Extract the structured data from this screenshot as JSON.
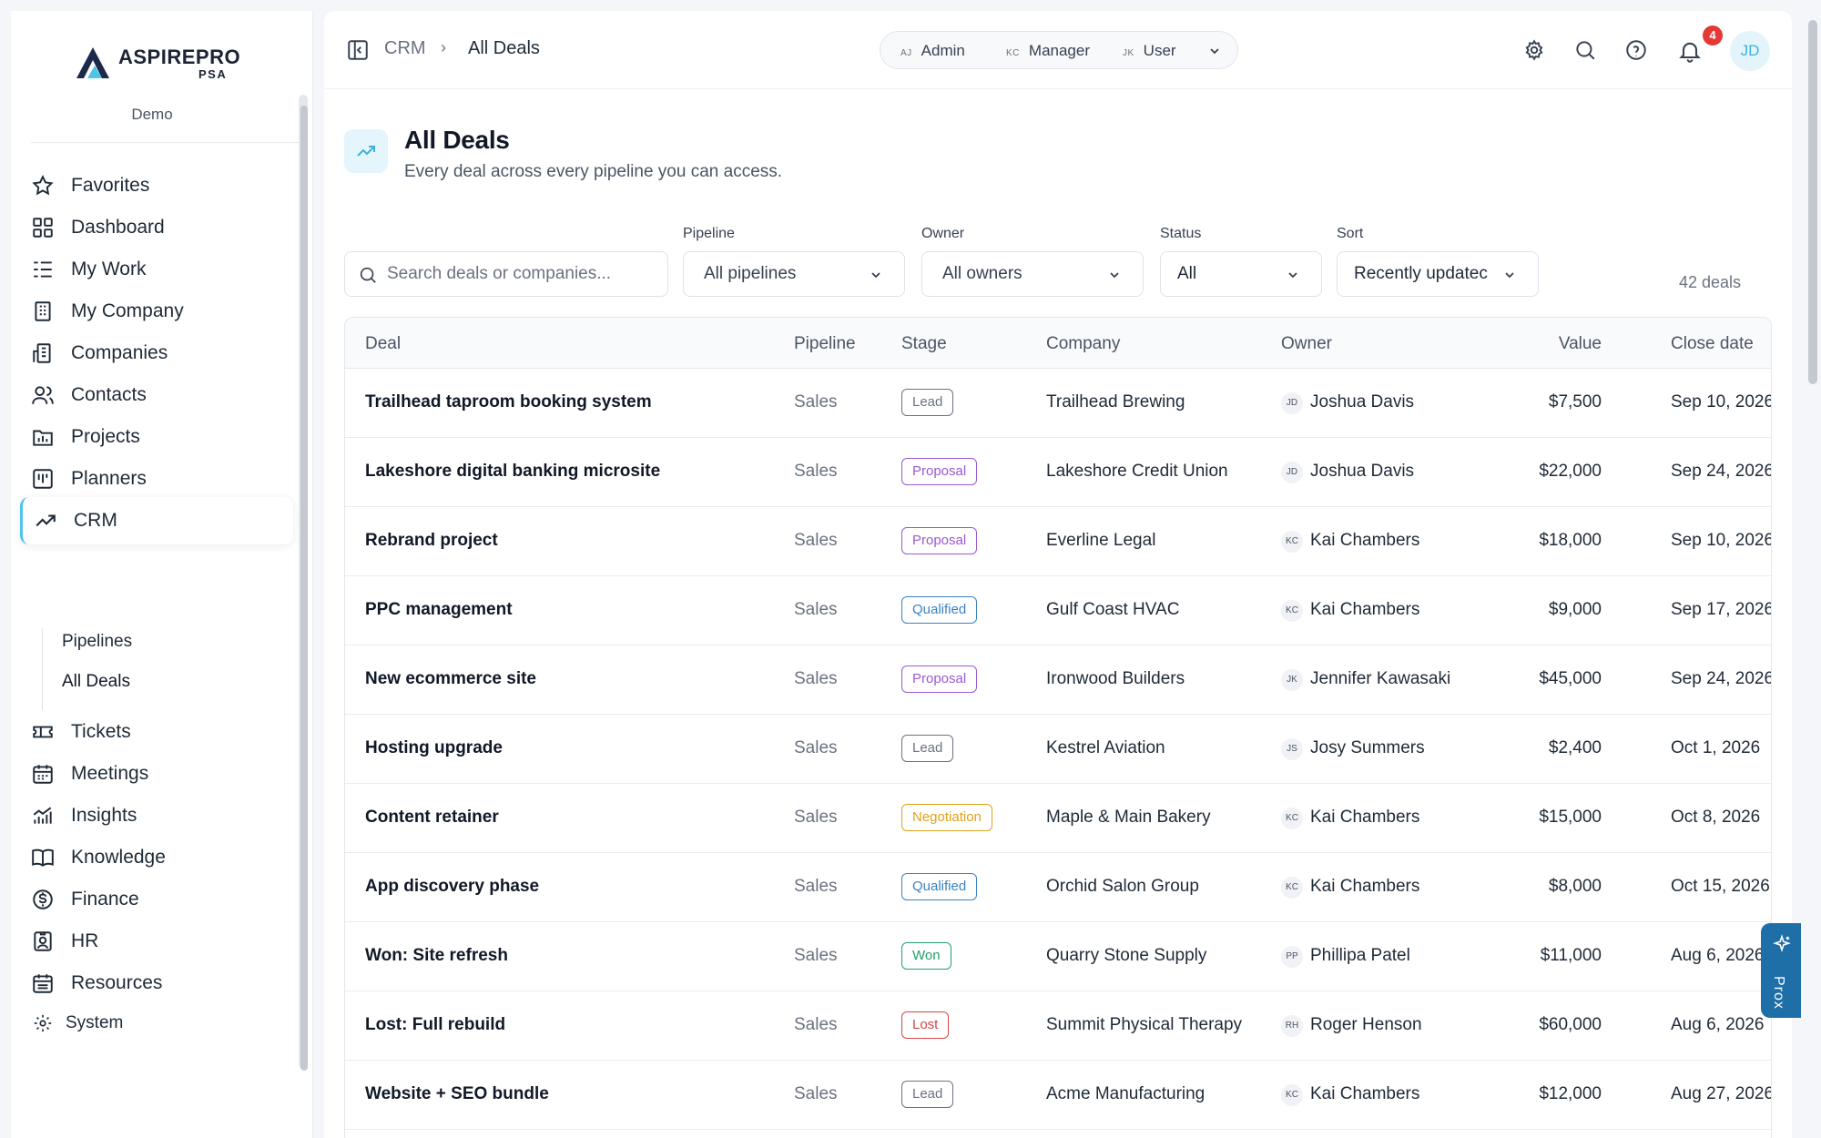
{
  "brand": {
    "name": "ASPIREPRO",
    "sub": "PSA",
    "tenant": "Demo"
  },
  "sidebar": {
    "items": [
      {
        "label": "Favorites",
        "icon": "star-icon"
      },
      {
        "label": "Dashboard",
        "icon": "grid-icon"
      },
      {
        "label": "My Work",
        "icon": "checklist-icon"
      },
      {
        "label": "My Company",
        "icon": "building-icon"
      },
      {
        "label": "Companies",
        "icon": "buildings-icon"
      },
      {
        "label": "Contacts",
        "icon": "users-icon"
      },
      {
        "label": "Projects",
        "icon": "folder-chart-icon"
      },
      {
        "label": "Planners",
        "icon": "board-icon"
      },
      {
        "label": "CRM",
        "icon": "trend-icon"
      },
      {
        "label": "Tickets",
        "icon": "ticket-icon"
      },
      {
        "label": "Meetings",
        "icon": "calendar-icon"
      },
      {
        "label": "Insights",
        "icon": "bar-chart-icon"
      },
      {
        "label": "Knowledge",
        "icon": "book-icon"
      },
      {
        "label": "Finance",
        "icon": "dollar-circle-icon"
      },
      {
        "label": "HR",
        "icon": "id-badge-icon"
      },
      {
        "label": "Resources",
        "icon": "calendar-list-icon"
      }
    ],
    "crm_sub": [
      {
        "label": "Pipelines"
      },
      {
        "label": "All Deals"
      }
    ],
    "system_label": "System"
  },
  "topbar": {
    "breadcrumb": [
      "CRM",
      "All Deals"
    ],
    "roles": [
      {
        "initials": "AJ",
        "label": "Admin"
      },
      {
        "initials": "KC",
        "label": "Manager"
      },
      {
        "initials": "JK",
        "label": "User"
      }
    ],
    "notification_count": "4",
    "avatar_initials": "JD"
  },
  "page": {
    "title": "All Deals",
    "subtitle": "Every deal across every pipeline you can access."
  },
  "filters": {
    "search_placeholder": "Search deals or companies...",
    "pipeline_label": "Pipeline",
    "pipeline_value": "All pipelines",
    "owner_label": "Owner",
    "owner_value": "All owners",
    "status_label": "Status",
    "status_value": "All",
    "sort_label": "Sort",
    "sort_value": "Recently updatec",
    "count": "42 deals"
  },
  "table": {
    "headers": [
      "Deal",
      "Pipeline",
      "Stage",
      "Company",
      "Owner",
      "Value",
      "Close date"
    ],
    "stage_colors": {
      "Lead": "#6b7280",
      "Proposal": "#9b59d0",
      "Qualified": "#3b82c4",
      "Negotiation": "#e0a21a",
      "Won": "#22a06b",
      "Lost": "#d64545"
    },
    "rows": [
      {
        "deal": "Trailhead taproom booking system",
        "pipeline": "Sales",
        "stage": "Lead",
        "company": "Trailhead Brewing",
        "owner_initials": "JD",
        "owner": "Joshua Davis",
        "value": "$7,500",
        "close": "Sep 10, 2026"
      },
      {
        "deal": "Lakeshore digital banking microsite",
        "pipeline": "Sales",
        "stage": "Proposal",
        "company": "Lakeshore Credit Union",
        "owner_initials": "JD",
        "owner": "Joshua Davis",
        "value": "$22,000",
        "close": "Sep 24, 2026"
      },
      {
        "deal": "Rebrand project",
        "pipeline": "Sales",
        "stage": "Proposal",
        "company": "Everline Legal",
        "owner_initials": "KC",
        "owner": "Kai Chambers",
        "value": "$18,000",
        "close": "Sep 10, 2026"
      },
      {
        "deal": "PPC management",
        "pipeline": "Sales",
        "stage": "Qualified",
        "company": "Gulf Coast HVAC",
        "owner_initials": "KC",
        "owner": "Kai Chambers",
        "value": "$9,000",
        "close": "Sep 17, 2026"
      },
      {
        "deal": "New ecommerce site",
        "pipeline": "Sales",
        "stage": "Proposal",
        "company": "Ironwood Builders",
        "owner_initials": "JK",
        "owner": "Jennifer Kawasaki",
        "value": "$45,000",
        "close": "Sep 24, 2026"
      },
      {
        "deal": "Hosting upgrade",
        "pipeline": "Sales",
        "stage": "Lead",
        "company": "Kestrel Aviation",
        "owner_initials": "JS",
        "owner": "Josy Summers",
        "value": "$2,400",
        "close": "Oct 1, 2026"
      },
      {
        "deal": "Content retainer",
        "pipeline": "Sales",
        "stage": "Negotiation",
        "company": "Maple & Main Bakery",
        "owner_initials": "KC",
        "owner": "Kai Chambers",
        "value": "$15,000",
        "close": "Oct 8, 2026"
      },
      {
        "deal": "App discovery phase",
        "pipeline": "Sales",
        "stage": "Qualified",
        "company": "Orchid Salon Group",
        "owner_initials": "KC",
        "owner": "Kai Chambers",
        "value": "$8,000",
        "close": "Oct 15, 2026"
      },
      {
        "deal": "Won: Site refresh",
        "pipeline": "Sales",
        "stage": "Won",
        "company": "Quarry Stone Supply",
        "owner_initials": "PP",
        "owner": "Phillipa Patel",
        "value": "$11,000",
        "close": "Aug 6, 2026"
      },
      {
        "deal": "Lost: Full rebuild",
        "pipeline": "Sales",
        "stage": "Lost",
        "company": "Summit Physical Therapy",
        "owner_initials": "RH",
        "owner": "Roger Henson",
        "value": "$60,000",
        "close": "Aug 6, 2026"
      },
      {
        "deal": "Website + SEO bundle",
        "pipeline": "Sales",
        "stage": "Lead",
        "company": "Acme Manufacturing",
        "owner_initials": "KC",
        "owner": "Kai Chambers",
        "value": "$12,000",
        "close": "Aug 27, 2026"
      }
    ]
  },
  "assistant": {
    "label": "Prox"
  },
  "colors": {
    "accent": "#4fc3e8",
    "badge": "#e53935",
    "assistant": "#1e6ea8"
  }
}
